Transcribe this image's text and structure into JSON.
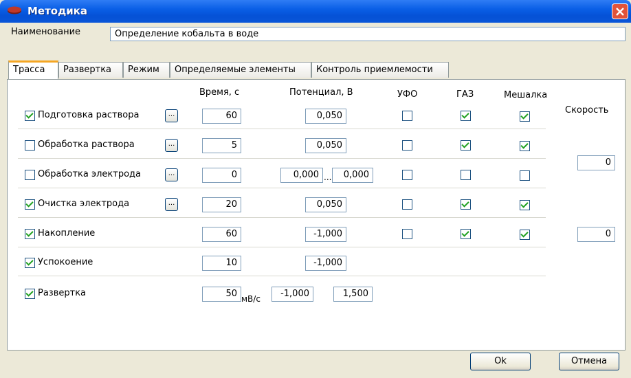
{
  "window": {
    "title": "Методика",
    "close_icon": "close-icon"
  },
  "name_field": {
    "label": "Наименование",
    "value": "Определение кобальта в воде"
  },
  "tabs": [
    {
      "label": "Трасса"
    },
    {
      "label": "Развертка"
    },
    {
      "label": "Режим"
    },
    {
      "label": "Определяемые элементы"
    },
    {
      "label": "Контроль приемлемости"
    }
  ],
  "headers": {
    "time": "Время, с",
    "potential": "Потенциал, В",
    "ufo": "УФО",
    "gaz": "ГАЗ",
    "mixer": "Мешалка",
    "speed": "Скорость"
  },
  "rows": [
    {
      "label": "Подготовка раствора",
      "enabled": true,
      "time": "60",
      "potential": "0,050",
      "ufo": false,
      "gaz": true,
      "mixer": true
    },
    {
      "label": "Обработка раствора",
      "enabled": false,
      "time": "5",
      "potential": "0,050",
      "ufo": false,
      "gaz": true,
      "mixer": true
    },
    {
      "label": "Обработка электрода",
      "enabled": false,
      "time": "0",
      "potential_from": "0,000",
      "potential_sep": "...",
      "potential_to": "0,000",
      "ufo": false,
      "gaz": false,
      "mixer": false
    },
    {
      "label": "Очистка электрода",
      "enabled": true,
      "time": "20",
      "potential": "0,050",
      "ufo": false,
      "gaz": true,
      "mixer": true
    },
    {
      "label": "Накопление",
      "enabled": true,
      "time": "60",
      "potential": "-1,000",
      "ufo": false,
      "gaz": true,
      "mixer": true
    },
    {
      "label": "Успокоение",
      "enabled": true,
      "time": "10",
      "potential": "-1,000"
    },
    {
      "label": "Развертка",
      "enabled": true,
      "rate": "50",
      "rate_unit": "мВ/с",
      "potential_from": "-1,000",
      "potential_to": "1,500"
    }
  ],
  "speed_values": [
    "0",
    "0"
  ],
  "buttons": {
    "ok": "Ok",
    "cancel": "Отмена"
  },
  "colors": {
    "titlebar": "#0551D6",
    "close": "#E2533A",
    "check": "#21A121",
    "tab_highlight": "#F5A623"
  }
}
